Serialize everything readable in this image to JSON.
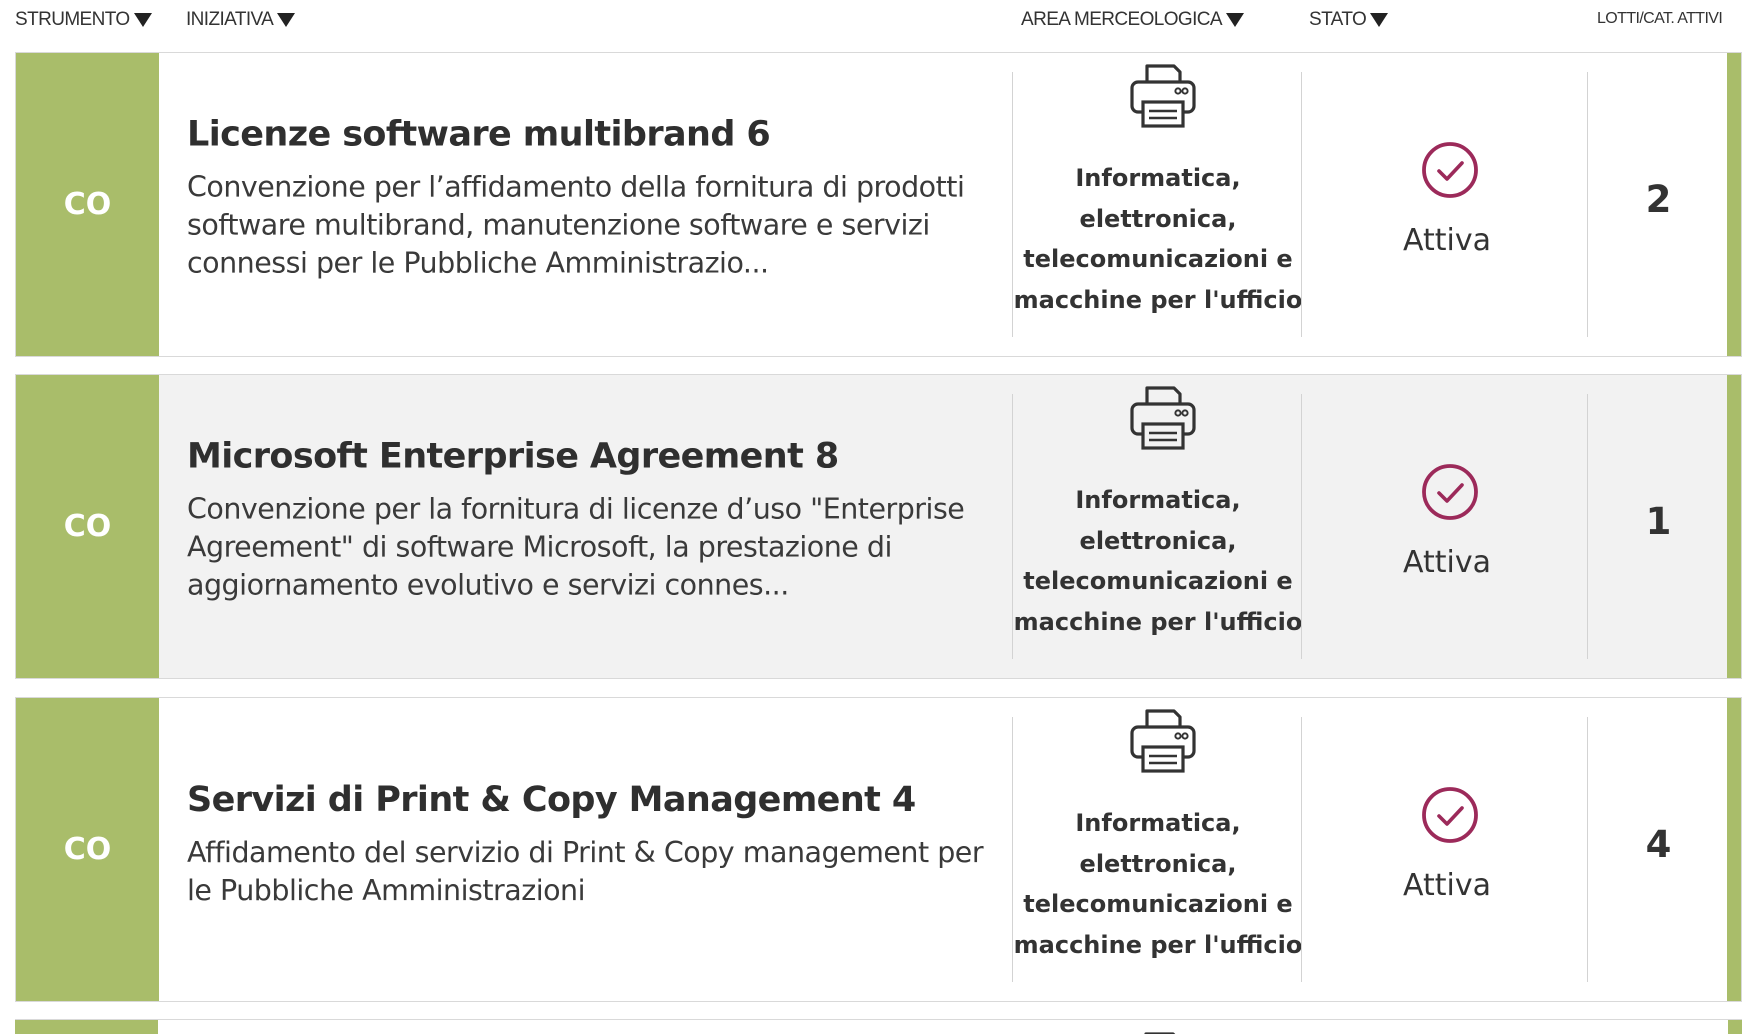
{
  "header": {
    "strumento": "STRUMENTO",
    "iniziativa": "INIZIATIVA",
    "area": "AREA MERCEOLOGICA",
    "stato": "STATO",
    "lotti": "LOTTI/CAT. ATTIVI"
  },
  "rows": [
    {
      "strumento": "CO",
      "title": "Licenze software multibrand 6",
      "desc": "Convenzione per l’affidamento della fornitura di prodotti software multibrand, manutenzione software e servizi connessi per le Pubbliche Amministrazio...",
      "area_icon": "printer-icon",
      "area": "Informatica, elettronica, telecomunicazioni e macchine per l'ufficio",
      "stato_icon": "check-circle-icon",
      "stato": "Attiva",
      "lotti": "2"
    },
    {
      "strumento": "CO",
      "title": "Microsoft Enterprise Agreement 8",
      "desc": "Convenzione per la fornitura di licenze d’uso \"Enterprise Agreement\" di software Microsoft, la prestazione di aggiornamento evolutivo e servizi connes...",
      "area_icon": "printer-icon",
      "area": "Informatica, elettronica, telecomunicazioni e macchine per l'ufficio",
      "stato_icon": "check-circle-icon",
      "stato": "Attiva",
      "lotti": "1"
    },
    {
      "strumento": "CO",
      "title": "Servizi di Print & Copy Management 4",
      "desc": "Affidamento del servizio di Print & Copy management per le Pubbliche Amministrazioni",
      "area_icon": "printer-icon",
      "area": "Informatica, elettronica, telecomunicazioni e macchine per l'ufficio",
      "stato_icon": "check-circle-icon",
      "stato": "Attiva",
      "lotti": "4"
    }
  ],
  "colors": {
    "strip": "#a9bd6a",
    "check": "#9c2a5a",
    "alt_row": "#f2f2f2"
  }
}
